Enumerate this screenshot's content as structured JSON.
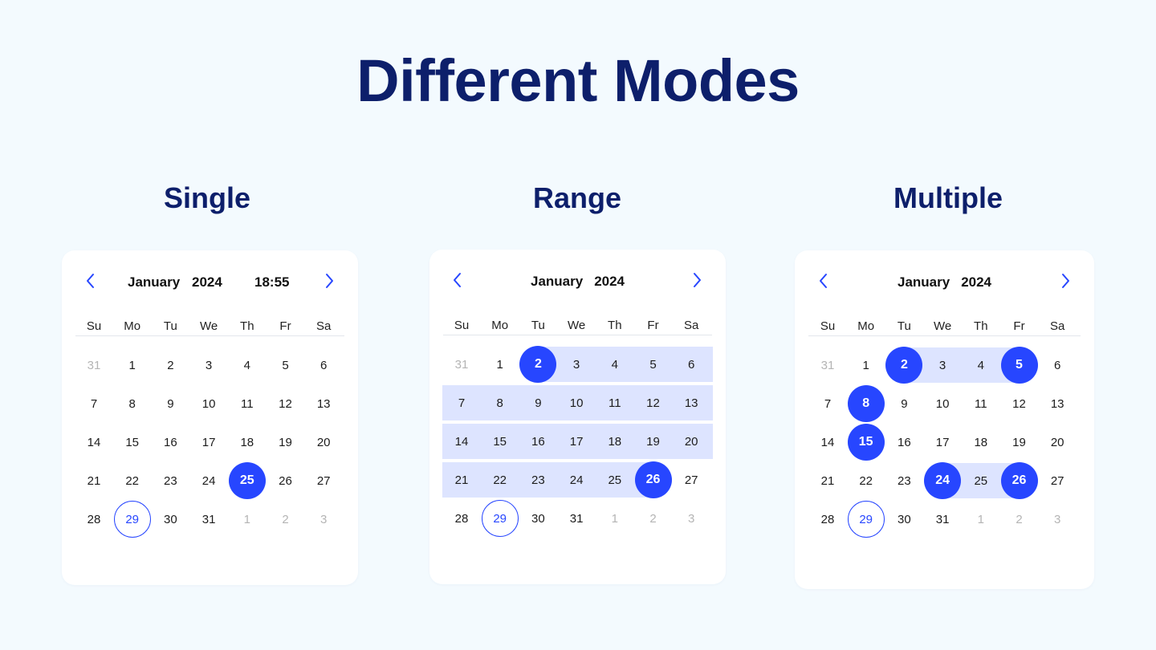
{
  "page": {
    "title": "Different Modes"
  },
  "colors": {
    "accent": "#2746ff",
    "range": "#dde4ff",
    "title": "#0d1f6b"
  },
  "icons": {
    "prev": "chevron-left-icon",
    "next": "chevron-right-icon"
  },
  "calendars": [
    {
      "mode": "Single",
      "month": "January",
      "year": "2024",
      "time": "18:55",
      "weekdays": [
        "Su",
        "Mo",
        "Tu",
        "We",
        "Th",
        "Fr",
        "Sa"
      ],
      "days": [
        [
          "31",
          "1",
          "2",
          "3",
          "4",
          "5",
          "6"
        ],
        [
          "7",
          "8",
          "9",
          "10",
          "11",
          "12",
          "13"
        ],
        [
          "14",
          "15",
          "16",
          "17",
          "18",
          "19",
          "20"
        ],
        [
          "21",
          "22",
          "23",
          "24",
          "25",
          "26",
          "27"
        ],
        [
          "28",
          "29",
          "30",
          "31",
          "1",
          "2",
          "3"
        ]
      ],
      "selected": [
        "25"
      ],
      "range_start": null,
      "range_end": null,
      "today": "29"
    },
    {
      "mode": "Range",
      "month": "January",
      "year": "2024",
      "time": "",
      "weekdays": [
        "Su",
        "Mo",
        "Tu",
        "We",
        "Th",
        "Fr",
        "Sa"
      ],
      "days": [
        [
          "31",
          "1",
          "2",
          "3",
          "4",
          "5",
          "6"
        ],
        [
          "7",
          "8",
          "9",
          "10",
          "11",
          "12",
          "13"
        ],
        [
          "14",
          "15",
          "16",
          "17",
          "18",
          "19",
          "20"
        ],
        [
          "21",
          "22",
          "23",
          "24",
          "25",
          "26",
          "27"
        ],
        [
          "28",
          "29",
          "30",
          "31",
          "1",
          "2",
          "3"
        ]
      ],
      "selected": [
        "2",
        "26"
      ],
      "range_start": "2",
      "range_end": "26",
      "today": "29"
    },
    {
      "mode": "Multiple",
      "month": "January",
      "year": "2024",
      "time": "",
      "weekdays": [
        "Su",
        "Mo",
        "Tu",
        "We",
        "Th",
        "Fr",
        "Sa"
      ],
      "days": [
        [
          "31",
          "1",
          "2",
          "3",
          "4",
          "5",
          "6"
        ],
        [
          "7",
          "8",
          "9",
          "10",
          "11",
          "12",
          "13"
        ],
        [
          "14",
          "15",
          "16",
          "17",
          "18",
          "19",
          "20"
        ],
        [
          "21",
          "22",
          "23",
          "24",
          "25",
          "26",
          "27"
        ],
        [
          "28",
          "29",
          "30",
          "31",
          "1",
          "2",
          "3"
        ]
      ],
      "selected": [
        "2",
        "5",
        "8",
        "15",
        "24",
        "26"
      ],
      "highlight_spans": [
        [
          "2",
          "5"
        ],
        [
          "24",
          "26"
        ]
      ],
      "range_start": null,
      "range_end": null,
      "today": "29"
    }
  ]
}
